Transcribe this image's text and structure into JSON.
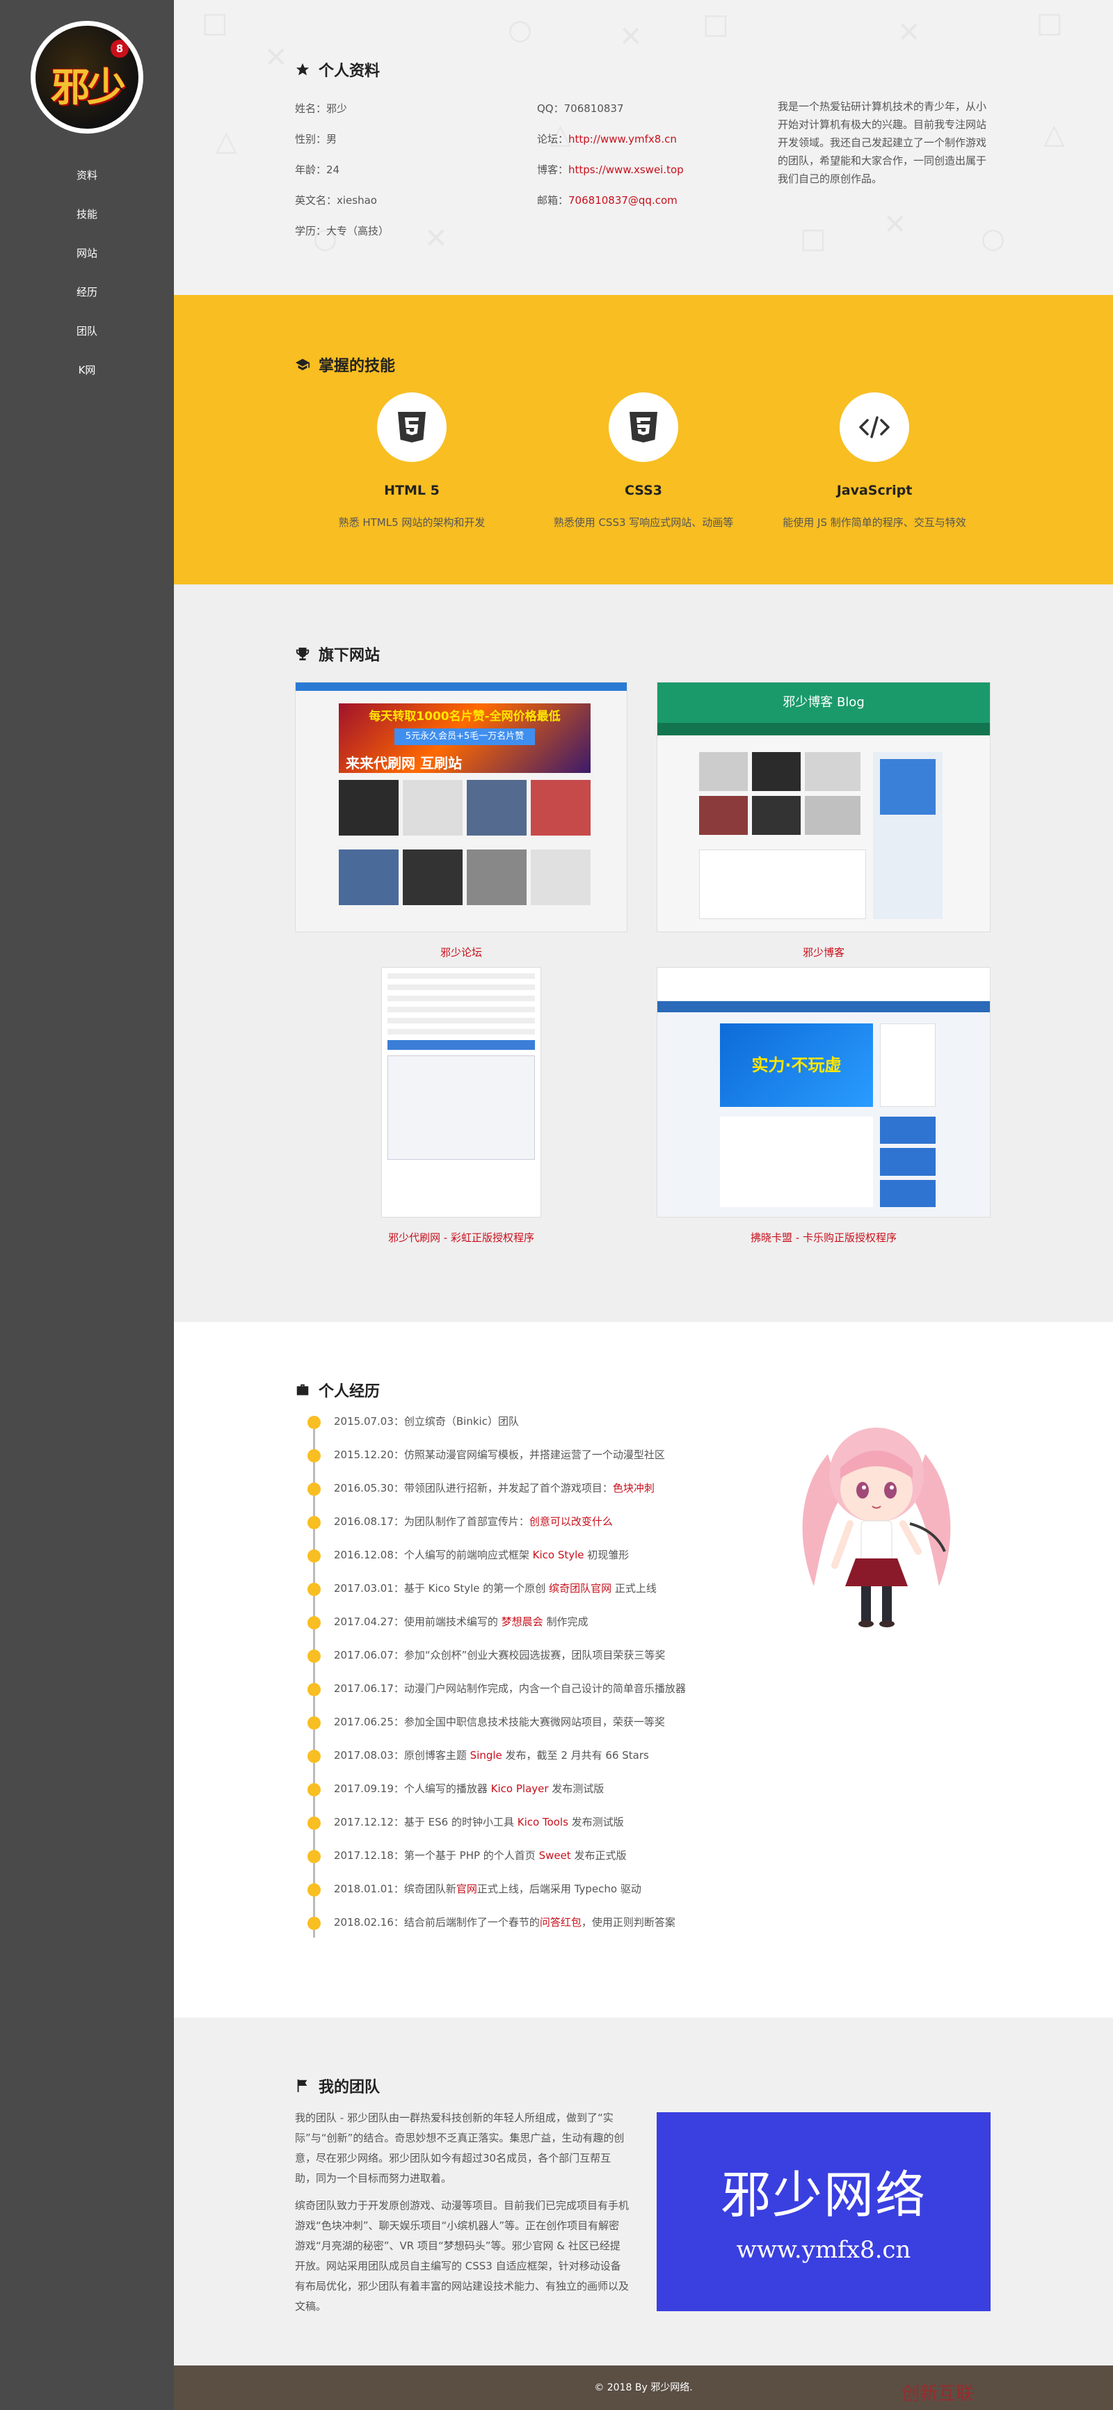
{
  "sidebar": {
    "avatar_text": "邪少",
    "avatar_badge": "8",
    "nav": [
      "资料",
      "技能",
      "网站",
      "经历",
      "团队",
      "K网"
    ]
  },
  "profile": {
    "title": "个人资料",
    "left": [
      "姓名：邪少",
      "性别：男",
      "年龄：24",
      "英文名：xieshao",
      "学历：大专（高技）"
    ],
    "qq": "QQ：706810837",
    "forum_label": "论坛：",
    "forum_link": "http://www.ymfx8.cn",
    "blog_label": "博客：",
    "blog_link": "https://www.xswei.top",
    "mail_label": "邮箱：",
    "mail_link": "706810837@qq.com",
    "bio": "我是一个热爱钻研计算机技术的青少年，从小开始对计算机有极大的兴趣。目前我专注网站开发领域。我还自己发起建立了一个制作游戏的团队，希望能和大家合作，一同创造出属于我们自己的原创作品。"
  },
  "skills": {
    "title": "掌握的技能",
    "items": [
      {
        "name": "HTML 5",
        "icon": "html5-icon",
        "desc": "熟悉 HTML5 网站的架构和开发"
      },
      {
        "name": "CSS3",
        "icon": "css3-icon",
        "desc": "熟悉使用 CSS3 写响应式网站、动画等"
      },
      {
        "name": "JavaScript",
        "icon": "code-icon",
        "desc": "能使用 JS 制作简单的程序、交互与特效"
      }
    ]
  },
  "websites": {
    "title": "旗下网站",
    "sites": [
      {
        "caption": "邪少论坛",
        "banner": "每天转取1000名片赞-全网价格最低",
        "banner2": "5元永久会员+5毛一万名片赞",
        "banner3": "来来代刷网 互刷站"
      },
      {
        "caption": "邪少博客",
        "header": "邪少博客 Blog"
      },
      {
        "caption": "邪少代刷网 - 彩虹正版授权程序"
      },
      {
        "caption": "拂晓卡盟 - 卡乐购正版授权程序",
        "banner": "实力·不玩虚"
      }
    ]
  },
  "experience": {
    "title": "个人经历",
    "items": [
      {
        "pre": "2015.07.03：创立缤奇（Binkic）团队",
        "hl": "",
        "post": ""
      },
      {
        "pre": "2015.12.20：仿照某动漫官网编写模板，并搭建运营了一个动漫型社区",
        "hl": "",
        "post": ""
      },
      {
        "pre": "2016.05.30：带领团队进行招新，并发起了首个游戏项目：",
        "hl": "色块冲刺",
        "post": ""
      },
      {
        "pre": "2016.08.17：为团队制作了首部宣传片：",
        "hl": "创意可以改变什么",
        "post": ""
      },
      {
        "pre": "2016.12.08：个人编写的前端响应式框架 ",
        "hl": "Kico Style",
        "post": " 初现雏形"
      },
      {
        "pre": "2017.03.01：基于 Kico Style 的第一个原创 ",
        "hl": "缤奇团队官网",
        "post": " 正式上线"
      },
      {
        "pre": "2017.04.27：使用前端技术编写的 ",
        "hl": "梦想晨会",
        "post": " 制作完成"
      },
      {
        "pre": "2017.06.07：参加“众创杯”创业大赛校园选拔赛，团队项目荣获三等奖",
        "hl": "",
        "post": ""
      },
      {
        "pre": "2017.06.17：动漫门户网站制作完成，内含一个自己设计的简单音乐播放器",
        "hl": "",
        "post": ""
      },
      {
        "pre": "2017.06.25：参加全国中职信息技术技能大赛微网站项目，荣获一等奖",
        "hl": "",
        "post": ""
      },
      {
        "pre": "2017.08.03：原创博客主题 ",
        "hl": "Single",
        "post": " 发布，截至 2 月共有 66 Stars"
      },
      {
        "pre": "2017.09.19：个人编写的播放器 ",
        "hl": "Kico Player",
        "post": " 发布测试版"
      },
      {
        "pre": "2017.12.12：基于 ES6 的时钟小工具 ",
        "hl": "Kico Tools",
        "post": " 发布测试版"
      },
      {
        "pre": "2017.12.18：第一个基于 PHP 的个人首页 ",
        "hl": "Sweet",
        "post": " 发布正式版"
      },
      {
        "pre": "2018.01.01：缤奇团队新",
        "hl": "官网",
        "post": "正式上线，后端采用 Typecho 驱动"
      },
      {
        "pre": "2018.02.16：结合前后端制作了一个春节的",
        "hl": "问答红包",
        "post": "，使用正则判断答案"
      }
    ]
  },
  "team": {
    "title": "我的团队",
    "p1": "我的团队 - 邪少团队由一群热爱科技创新的年轻人所组成，做到了“实际”与“创新”的结合。奇思妙想不乏真正落实。集思广益，生动有趣的创意，尽在邪少网络。邪少团队如今有超过30名成员，各个部门互帮互助，同为一个目标而努力进取着。",
    "p2": "缤奇团队致力于开发原创游戏、动漫等项目。目前我们已完成项目有手机游戏“色块冲刺”、聊天娱乐项目“小缤机器人”等。正在创作项目有解密游戏“月亮湖的秘密”、VR 项目“梦想码头”等。邪少官网 & 社区已经提开放。网站采用团队成员自主编写的 CSS3 自适应框架，针对移动设备有布局优化，邪少团队有着丰富的网站建设技术能力、有独立的画师以及文稿。",
    "logo_title": "邪少网络",
    "logo_url": "www.ymfx8.cn"
  },
  "footer": "© 2018 By 邪少网络.",
  "watermark": "创新互联",
  "colors": {
    "sidebar": "#4a4a4a",
    "accent": "#f8be22",
    "link": "#c8101c",
    "team_logo": "#3a3fe0"
  }
}
